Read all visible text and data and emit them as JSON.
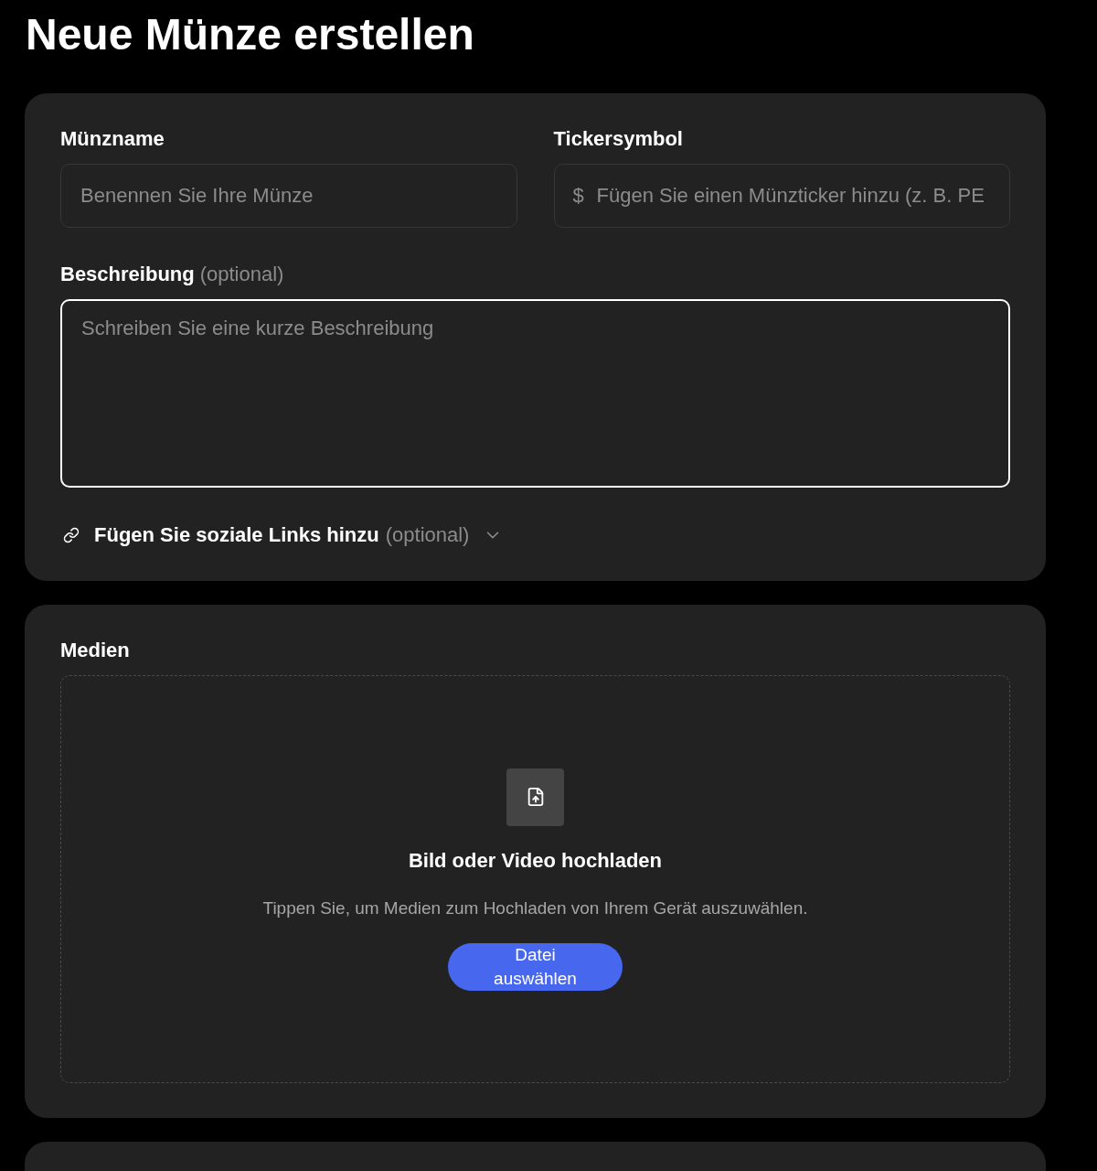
{
  "page_title": "Neue Münze erstellen",
  "details_card": {
    "fields": [
      {
        "kind": "input",
        "label": "Münzname",
        "placeholder": "Benennen Sie Ihre Münze"
      },
      {
        "kind": "prefixed_input",
        "label": "Tickersymbol",
        "prefix": "$",
        "placeholder": "Fügen Sie einen Münzticker hinzu (z. B. PE"
      }
    ],
    "description": {
      "label": "Beschreibung",
      "label_note": "(optional)",
      "placeholder": "Schreiben Sie eine kurze Beschreibung",
      "focused": true
    },
    "social_links": {
      "label": "Fügen Sie soziale Links hinzu",
      "label_note": "(optional)",
      "expanded": false
    }
  },
  "media_card": {
    "label": "Medien",
    "upload": {
      "title": "Bild oder Video hochladen",
      "hint": "Tippen Sie, um Medien zum Hochladen von Ihrem Gerät auszuwählen.",
      "button": "Datei auswählen"
    }
  }
}
